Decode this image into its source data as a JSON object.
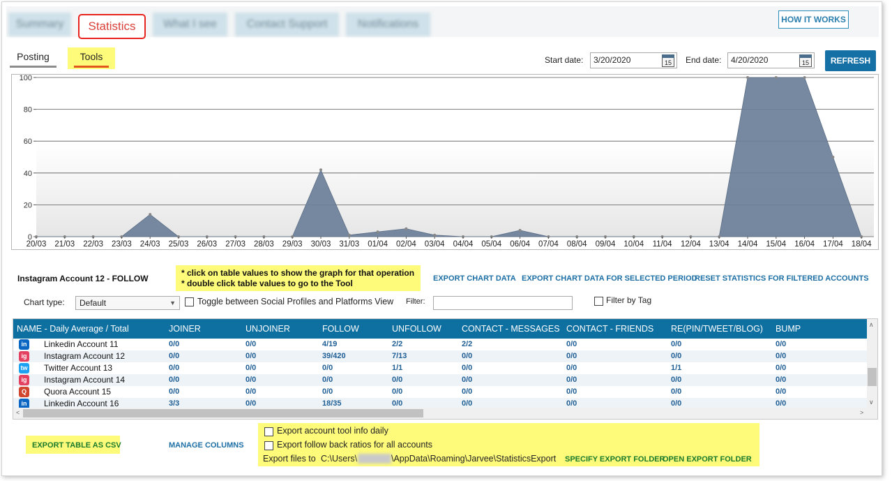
{
  "top_tabs": [
    {
      "label": "Summary",
      "active": false
    },
    {
      "label": "Statistics",
      "active": true
    },
    {
      "label": "What I see",
      "active": false
    },
    {
      "label": "Contact Support",
      "active": false
    },
    {
      "label": "Notifications",
      "active": false
    }
  ],
  "how_it_works_label": "HOW IT WORKS",
  "sub_tabs": [
    {
      "label": "Posting",
      "active": false
    },
    {
      "label": "Tools",
      "active": true
    }
  ],
  "date_filter": {
    "start_label": "Start date:",
    "start_value": "3/20/2020",
    "end_label": "End date:",
    "end_value": "4/20/2020",
    "calendar_day": "15",
    "refresh_label": "REFRESH"
  },
  "chart_data": {
    "type": "area",
    "categories": [
      "20/03",
      "21/03",
      "22/03",
      "23/03",
      "24/03",
      "25/03",
      "26/03",
      "27/03",
      "28/03",
      "29/03",
      "30/03",
      "31/03",
      "01/04",
      "02/04",
      "03/04",
      "04/04",
      "05/04",
      "06/04",
      "07/04",
      "08/04",
      "09/04",
      "10/04",
      "11/04",
      "12/04",
      "13/04",
      "14/04",
      "15/04",
      "16/04",
      "17/04",
      "18/04"
    ],
    "values": [
      0,
      0,
      0,
      0,
      14,
      0,
      0,
      0,
      0,
      0,
      42,
      1,
      3,
      5,
      1,
      0,
      0,
      4,
      0,
      0,
      0,
      0,
      0,
      0,
      0,
      100,
      100,
      100,
      50,
      0
    ],
    "yticks": [
      0,
      20,
      40,
      60,
      80,
      100
    ],
    "ylim": [
      0,
      100
    ],
    "grid": true,
    "fill_color": "#6b7f99"
  },
  "selection_title": "Instagram Account 12 - FOLLOW",
  "notes": [
    "* click on table values to show the graph for that operation",
    "* double click table values to go to the Tool"
  ],
  "links": {
    "export_chart": "EXPORT CHART DATA",
    "export_period": "EXPORT CHART DATA FOR SELECTED PERIOD",
    "reset_stats": "RESET STATISTICS FOR FILTERED ACCOUNTS",
    "export_csv": "EXPORT TABLE AS CSV",
    "manage_columns": "MANAGE COLUMNS",
    "specify_folder": "SPECIFY EXPORT FOLDER",
    "open_folder": "OPEN EXPORT FOLDER"
  },
  "controls": {
    "chart_type_label": "Chart type:",
    "chart_type_value": "Default",
    "toggle_label": "Toggle between Social Profiles and Platforms View",
    "filter_label": "Filter:",
    "filter_value": "",
    "filter_by_tag_label": "Filter by Tag"
  },
  "table": {
    "columns": [
      "NAME - Daily Average / Total",
      "JOINER",
      "UNJOINER",
      "FOLLOW",
      "UNFOLLOW",
      "CONTACT - MESSAGES",
      "CONTACT - FRIENDS",
      "RE(PIN/TWEET/BLOG)",
      "BUMP"
    ],
    "rows": [
      {
        "platform": "linkedin",
        "icon": "in",
        "name": "Linkedin Account 11",
        "cells": [
          "0/0",
          "0/0",
          "4/19",
          "2/2",
          "2/2",
          "0/0",
          "0/0",
          "0/0"
        ]
      },
      {
        "platform": "instagram",
        "icon": "ig",
        "name": "Instagram Account 12",
        "cells": [
          "0/0",
          "0/0",
          "39/420",
          "7/13",
          "0/0",
          "0/0",
          "0/0",
          "0/0"
        ]
      },
      {
        "platform": "twitter",
        "icon": "tw",
        "name": "Twitter Account 13",
        "cells": [
          "0/0",
          "0/0",
          "0/0",
          "1/1",
          "0/0",
          "0/0",
          "1/1",
          "0/0"
        ]
      },
      {
        "platform": "instagram",
        "icon": "ig",
        "name": "Instagram Account 14",
        "cells": [
          "0/0",
          "0/0",
          "0/0",
          "0/0",
          "0/0",
          "0/0",
          "0/0",
          "0/0"
        ]
      },
      {
        "platform": "quora",
        "icon": "Q",
        "name": "Quora Account 15",
        "cells": [
          "0/0",
          "0/0",
          "0/0",
          "0/0",
          "0/0",
          "0/0",
          "0/0",
          "0/0"
        ]
      },
      {
        "platform": "linkedin",
        "icon": "in",
        "name": "Linkedin Account 16",
        "cells": [
          "3/3",
          "0/0",
          "18/35",
          "0/0",
          "0/0",
          "0/0",
          "0/0",
          "0/0"
        ]
      }
    ]
  },
  "export_options": {
    "daily_label": "Export account tool info daily",
    "ratios_label": "Export follow back ratios for all accounts",
    "files_label": "Export files to",
    "path_prefix": "C:\\Users\\",
    "path_suffix": "\\AppData\\Roaming\\Jarvee\\StatisticsExport"
  },
  "colors": {
    "accent": "#0e6fa1",
    "highlight": "#fefb7b",
    "active_tab": "#e8231d",
    "linkedin": "#0a66c2",
    "instagram": "#e4405f",
    "twitter": "#1da1f2",
    "quora": "#d2452f"
  }
}
